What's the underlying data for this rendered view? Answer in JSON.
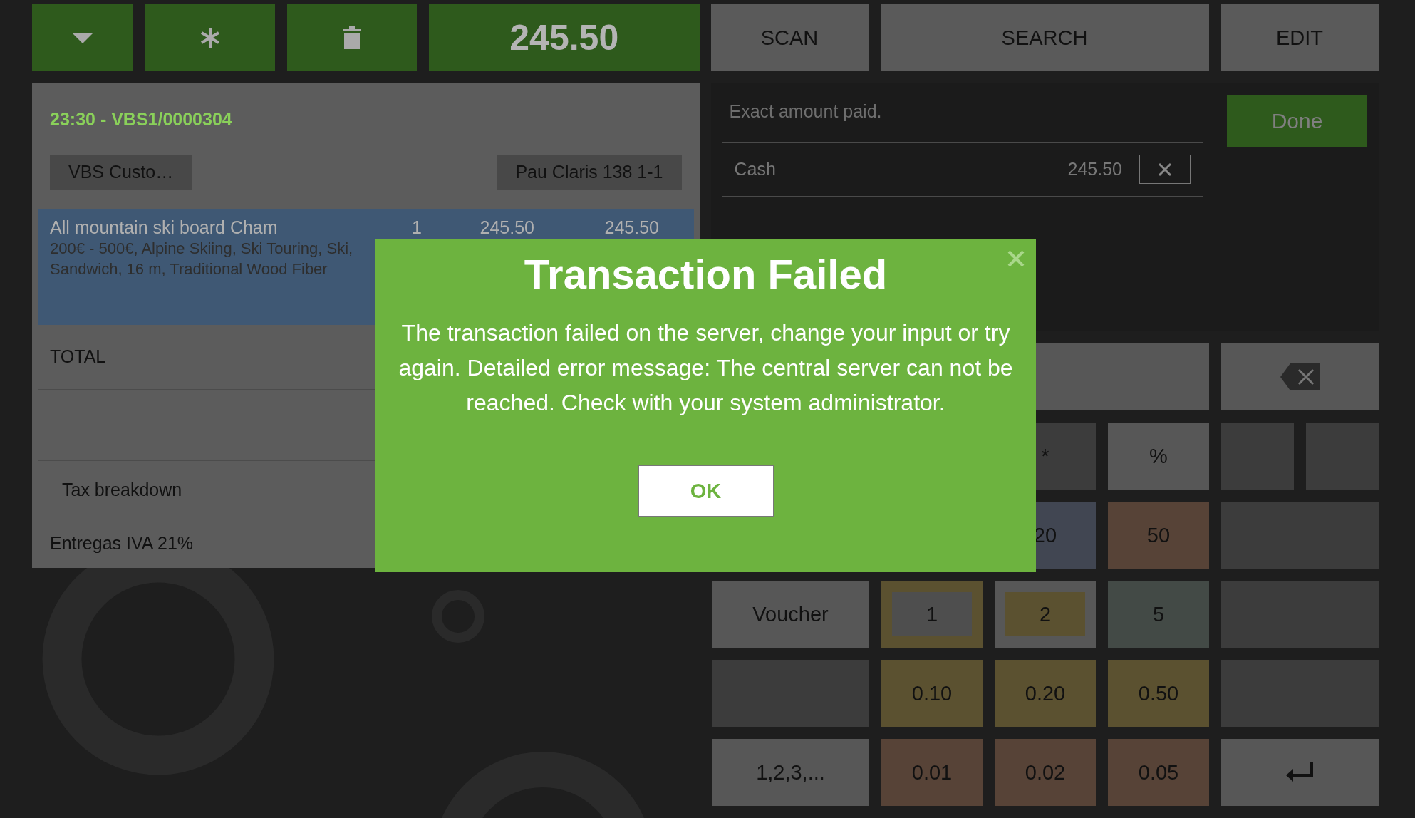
{
  "toolbar": {
    "icon_buttons": [
      {
        "kind": "dropdown"
      },
      {
        "kind": "asterisk"
      },
      {
        "kind": "trash"
      }
    ],
    "total": "245.50",
    "actions": [
      "SCAN",
      "SEARCH",
      "EDIT"
    ]
  },
  "receipt": {
    "header": "23:30 - VBS1/0000304",
    "customer": "VBS Custo…",
    "address": "Pau Claris 138 1-1",
    "lines": [
      {
        "name": "All mountain ski board Cham",
        "qty": "1",
        "price": "245.50",
        "amount": "245.50",
        "description": [
          "200€ - 500€, Alpine Skiing, Ski Touring, Ski,",
          "Sandwich, 16 m, Traditional Wood Fiber"
        ],
        "selected": true
      }
    ],
    "total_label": "TOTAL",
    "tax_title": "Tax breakdown",
    "taxes": [
      "Entregas IVA 21%"
    ]
  },
  "payment": {
    "status": "Exact amount paid.",
    "done": "Done",
    "payments": [
      {
        "method": "Cash",
        "amount": "245.50"
      }
    ]
  },
  "keypad": [
    [
      {
        "kind": "display"
      },
      {
        "kind": "backspace"
      }
    ],
    [
      {
        "kind": "key",
        "label": "*",
        "color": "#3c3c3c"
      },
      {
        "kind": "key",
        "label": "%",
        "color": "#575757"
      },
      {
        "kind": "split",
        "color": "#3c3c3c"
      }
    ],
    [
      {
        "kind": "key",
        "label": "20",
        "color": "#414652"
      },
      {
        "kind": "key",
        "label": "50",
        "color": "#574337"
      },
      {
        "kind": "wide",
        "color": "#3c3c3c"
      }
    ],
    [
      {
        "kind": "wide",
        "label": "Voucher",
        "color": "#575757"
      },
      {
        "kind": "key",
        "label": "1",
        "color": "#5b5130",
        "face": {
          "color": "#4e4e4e"
        }
      },
      {
        "kind": "key",
        "label": "2",
        "color": "#575757",
        "face": {
          "color": "#5b5130"
        }
      },
      {
        "kind": "key",
        "label": "5",
        "color": "#434a46"
      },
      {
        "kind": "wide",
        "color": "#3c3c3c"
      }
    ],
    [
      {
        "kind": "wide",
        "color": "#3c3c3c"
      },
      {
        "kind": "key",
        "label": "0.10",
        "color": "#5b5130"
      },
      {
        "kind": "key",
        "label": "0.20",
        "color": "#5b5130"
      },
      {
        "kind": "key",
        "label": "0.50",
        "color": "#5b5130"
      },
      {
        "kind": "wide",
        "color": "#3c3c3c"
      }
    ],
    [
      {
        "kind": "wide",
        "label": "1,2,3,...",
        "color": "#575757"
      },
      {
        "kind": "key",
        "label": "0.01",
        "color": "#574337"
      },
      {
        "kind": "key",
        "label": "0.02",
        "color": "#574337"
      },
      {
        "kind": "key",
        "label": "0.05",
        "color": "#574337"
      },
      {
        "kind": "enter",
        "color": "#575757"
      }
    ]
  ],
  "dialog": {
    "title": "Transaction Failed",
    "message": "The transaction failed on the server, change your input or try again. Detailed error message: The central server can not be reached. Check with your system administrator.",
    "ok": "OK"
  }
}
